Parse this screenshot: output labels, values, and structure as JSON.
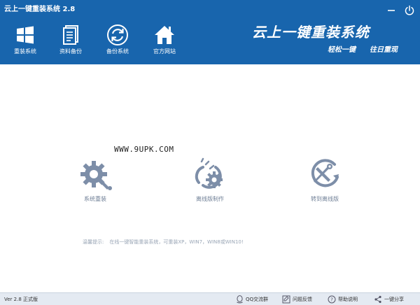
{
  "window": {
    "title": "云上一键重装系统 2.8"
  },
  "nav": [
    {
      "label": "重装系统",
      "icon": "windows-icon"
    },
    {
      "label": "资料备份",
      "icon": "document-icon"
    },
    {
      "label": "备份系统",
      "icon": "refresh-icon"
    },
    {
      "label": "官方网站",
      "icon": "home-icon"
    }
  ],
  "brand": {
    "title": "云上一键重装系统",
    "slogan_left": "轻松一键",
    "slogan_right": "往日重现"
  },
  "watermark": "WWW.9UPK.COM",
  "actions": [
    {
      "label": "系统重装",
      "icon": "gear-wrench-icon"
    },
    {
      "label": "离线版制作",
      "icon": "offline-gear-icon"
    },
    {
      "label": "转到离线版",
      "icon": "tools-arrow-icon"
    }
  ],
  "tip": {
    "label": "温馨提示:",
    "text": "在线一键智能重装系统，可重装XP，WIN7，WIN8或WIN10!"
  },
  "footer": {
    "version": "Ver 2.8 正式版",
    "items": [
      {
        "label": "QQ交流群",
        "icon": "qq-icon"
      },
      {
        "label": "问题反馈",
        "icon": "feedback-icon"
      },
      {
        "label": "帮助说明",
        "icon": "help-icon"
      },
      {
        "label": "一键分享",
        "icon": "share-icon"
      }
    ]
  },
  "colors": {
    "header_bg": "#1865ad",
    "footer_bg": "#e4eaf2",
    "icon_gray": "#7d8ea8",
    "label_gray": "#6f7f96"
  }
}
